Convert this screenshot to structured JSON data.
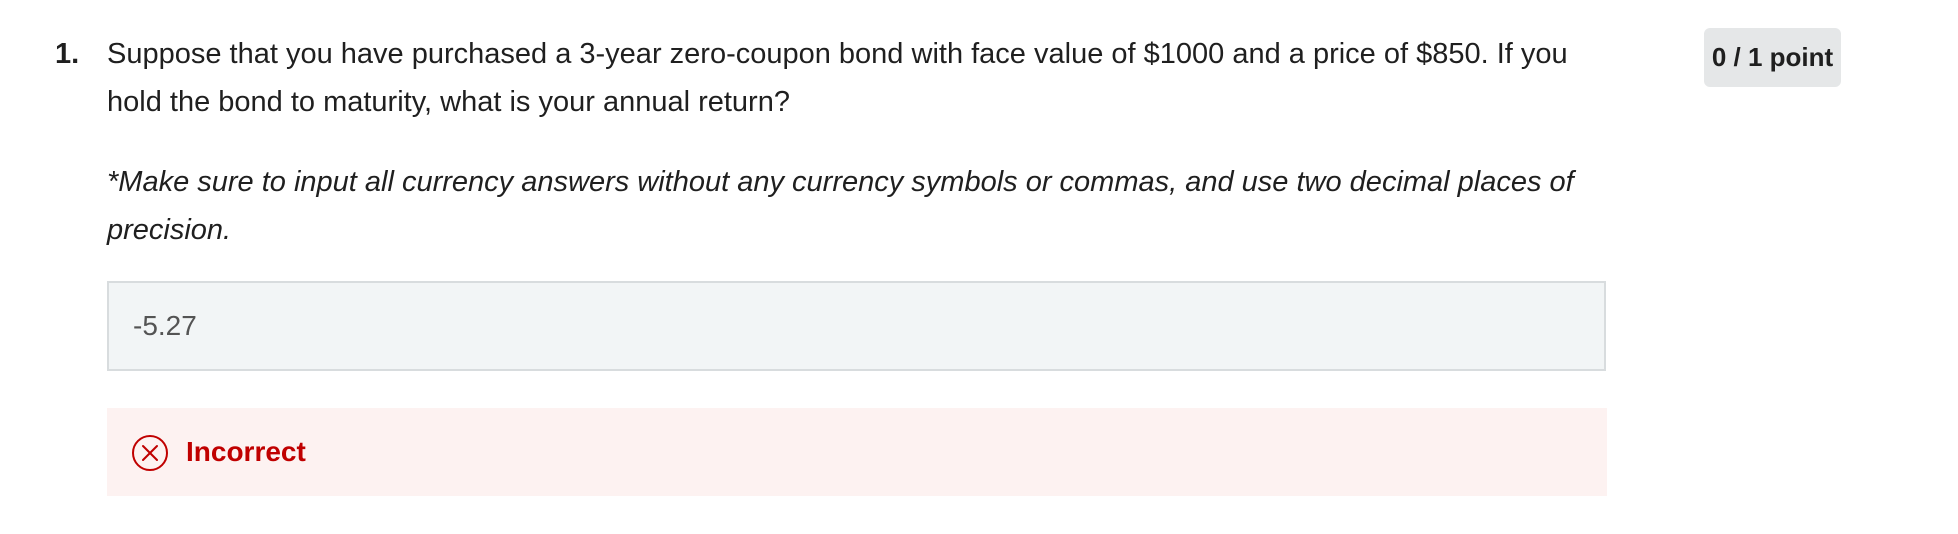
{
  "question": {
    "number": "1.",
    "text": "Suppose that you have purchased a 3-year zero-coupon bond with face value of $1000 and a price of $850. If you hold the bond to maturity, what is your annual return?",
    "note": "*Make sure to input all currency answers without any currency symbols or commas, and use two decimal places of precision."
  },
  "answer": {
    "value": "-5.27"
  },
  "feedback": {
    "status": "Incorrect",
    "icon": "x-circle-icon",
    "color": "#c00000"
  },
  "score": {
    "label": "0 / 1 point"
  }
}
